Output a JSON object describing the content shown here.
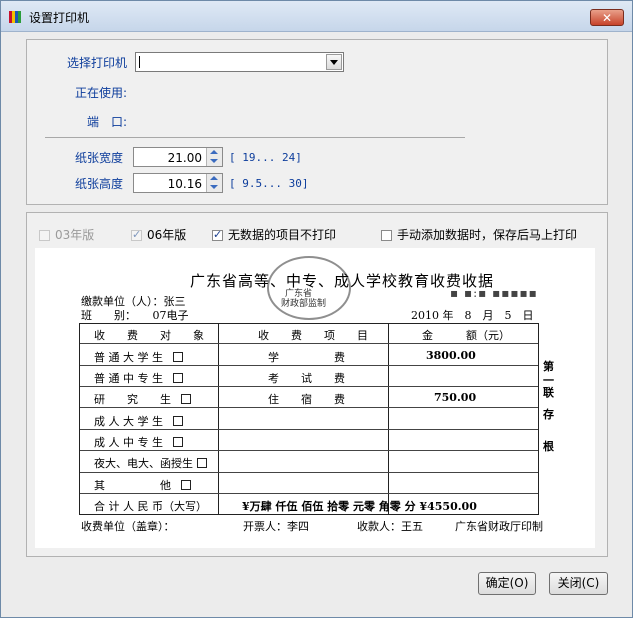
{
  "window": {
    "title": "设置打印机",
    "close_label": "✕"
  },
  "printer": {
    "select_label": "选择打印机",
    "select_value": "",
    "in_use_label": "正在使用:",
    "in_use_value": "",
    "port_label": "端　口:",
    "port_value": ""
  },
  "paper": {
    "width_label": "纸张宽度",
    "width_value": "21.00",
    "width_range": "[ 19... 24]",
    "height_label": "纸张高度",
    "height_value": "10.16",
    "height_range": "[ 9.5... 30]"
  },
  "options": {
    "v03_label": "03年版",
    "v03_checked": false,
    "v06_label": "06年版",
    "v06_checked": true,
    "skip_empty_label": "无数据的项目不打印",
    "skip_empty_checked": true,
    "auto_print_label": "手动添加数据时，保存后马上打印",
    "auto_print_checked": false
  },
  "receipt": {
    "title": "广东省高等、中专、成人学校教育收费收据",
    "stamp_line1": "广东省",
    "stamp_line2": "财政部监制",
    "payer_label": "缴款单位（人）：张三",
    "class_label": "班　　别：　　07电子",
    "date": "2010 年　8　月　5　日",
    "noise": "▪ ▪:▪ ▪▪▪▪▪",
    "col_target": "收　　费　　对　　象",
    "col_item": "收　　费　　项　　目",
    "col_amount": "金　　　额（元）",
    "rows": [
      {
        "target": "普 通 大 学 生",
        "item": "学　　　　　费",
        "amount": "3800.00"
      },
      {
        "target": "普 通 中 专 生",
        "item": "考　　试　　费",
        "amount": ""
      },
      {
        "target": "研　　究　　生",
        "item": "住　　宿　　费",
        "amount": "750.00"
      },
      {
        "target": "成 人 大 学 生",
        "item": "",
        "amount": ""
      },
      {
        "target": "成 人 中 专 生",
        "item": "",
        "amount": ""
      },
      {
        "target": "夜大、电大、函授生",
        "item": "",
        "amount": ""
      },
      {
        "target": "其　　　　　他",
        "item": "",
        "amount": ""
      }
    ],
    "total_label": "合 计 人 民 币（大写）",
    "total_text": "¥万肆 仟伍 佰伍 拾零 元零 角零 分 ¥4550.00",
    "side_1": "第",
    "side_2": "一",
    "side_3": "联",
    "side_4": "存",
    "side_5": "根",
    "footer_unit": "收费单位（盖章）：",
    "footer_issuer": "开票人：李四",
    "footer_payee": "收款人：王五",
    "footer_printer": "广东省财政厅印制"
  },
  "buttons": {
    "ok": "确定(O)",
    "close": "关闭(C)"
  }
}
